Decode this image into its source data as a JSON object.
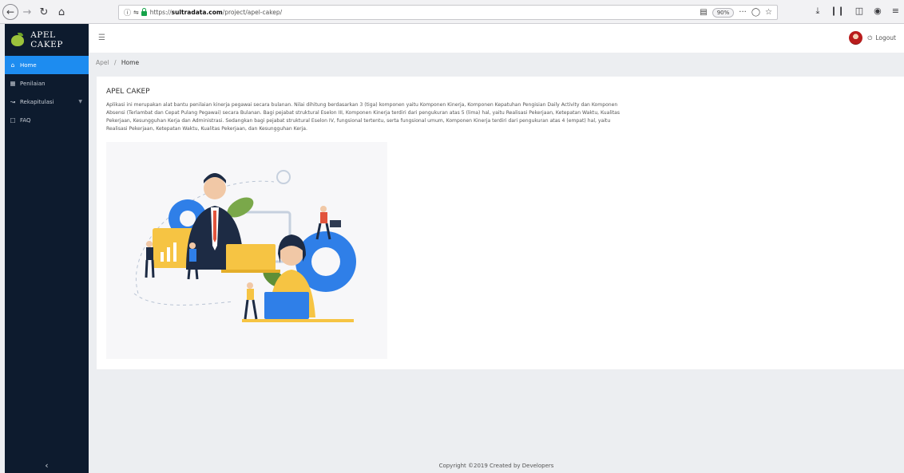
{
  "browser": {
    "url_prefix": "https://",
    "url_host": "sultradata.com",
    "url_path": "/project/apel-cakep/",
    "zoom": "90%",
    "more": "···"
  },
  "sidebar": {
    "brand": "APEL CAKEP",
    "items": [
      {
        "label": "Home"
      },
      {
        "label": "Penilaian"
      },
      {
        "label": "Rekapitulasi"
      },
      {
        "label": "FAQ"
      }
    ],
    "collapse": "‹"
  },
  "header": {
    "menu_icon": "☰",
    "logout": "Logout"
  },
  "breadcrumb": {
    "parent": "Apel",
    "separator": "/",
    "current": "Home"
  },
  "content": {
    "title": "APEL CAKEP",
    "description": "Aplikasi ini merupakan alat bantu penilaian kinerja pegawai secara bulanan. Nilai dihitung berdasarkan 3 (tiga) komponen yaitu Komponen Kinerja, Komponen Kepatuhan Pengisian Daily Activity dan Komponen Absensi (Terlambat dan Cepat Pulang Pegawai) secara Bulanan. Bagi pejabat struktural Eselon III, Komponen Kinerja terdiri dari pengukuran atas 5 (lima) hal, yaitu Realisasi Pekerjaan, Ketepatan Waktu, Kualitas Pekerjaan, Kesungguhan Kerja dan Administrasi. Sedangkan bagi pejabat struktural Eselon IV, fungsional tertentu, serta fungsional umum, Komponen Kinerja terdiri dari pengukuran atas 4 (empat) hal, yaitu Realisasi Pekerjaan, Ketepatan Waktu, Kualitas Pekerjaan, dan Kesungguhan Kerja."
  },
  "footer": {
    "copyright": "Copyright ©2019 Created by Developers"
  },
  "colors": {
    "sidebar_bg": "#0d1b2e",
    "active_item": "#1d8cf0",
    "page_bg": "#eceef1"
  }
}
